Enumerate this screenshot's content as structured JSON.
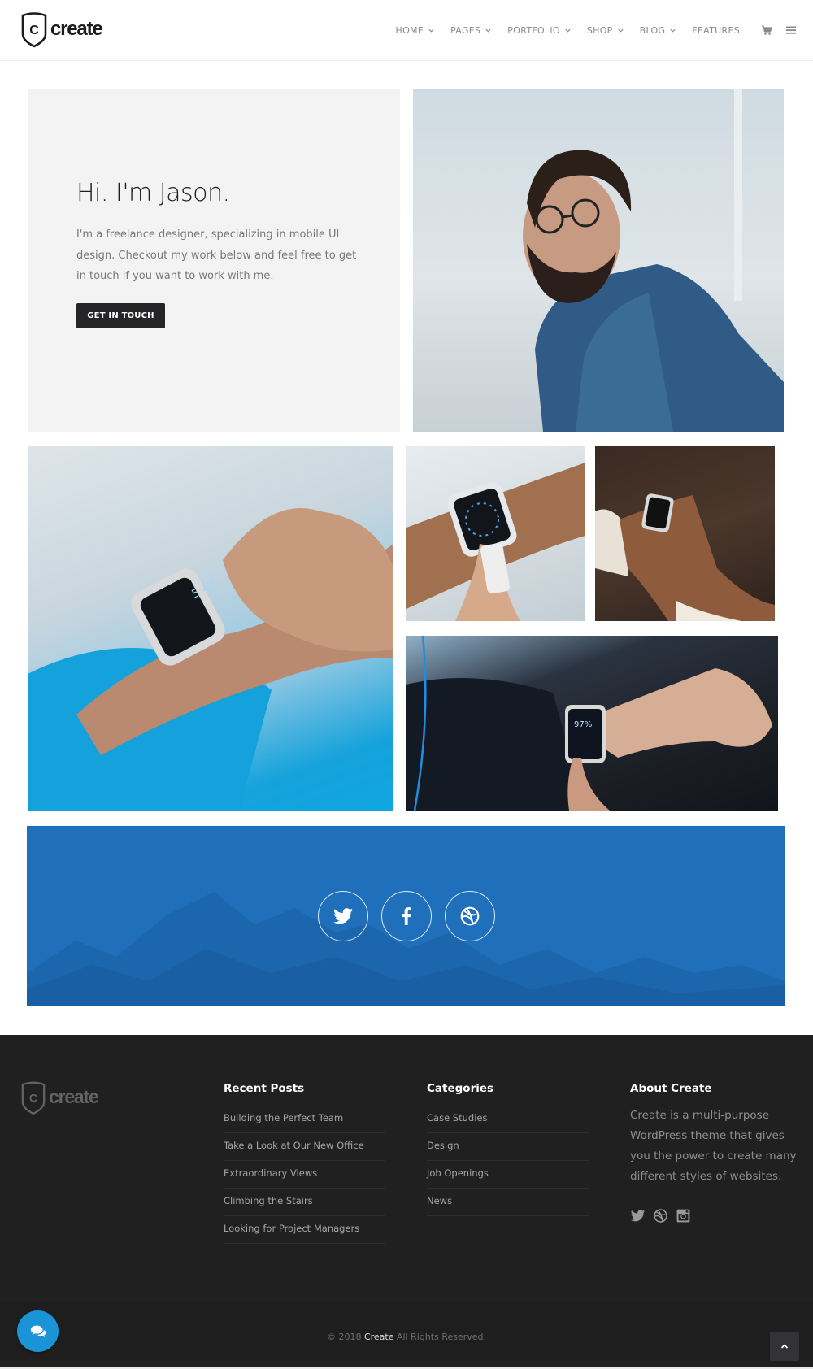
{
  "brand": {
    "name": "create",
    "logo_letter": "C"
  },
  "nav": {
    "items": [
      {
        "label": "HOME",
        "has_dropdown": true
      },
      {
        "label": "PAGES",
        "has_dropdown": true
      },
      {
        "label": "PORTFOLIO",
        "has_dropdown": true
      },
      {
        "label": "SHOP",
        "has_dropdown": true
      },
      {
        "label": "BLOG",
        "has_dropdown": true
      },
      {
        "label": "FEATURES",
        "has_dropdown": false
      }
    ],
    "icons": [
      "cart-icon",
      "menu-icon"
    ]
  },
  "hero": {
    "title": "Hi. I'm Jason.",
    "body": "I'm a freelance designer, specializing in mobile UI design. Checkout my work below and feel free to get in touch if you want to work with me.",
    "button_label": "GET IN TOUCH"
  },
  "gallery": [
    {
      "name": "portrait-photo",
      "subject": "bearded man with glasses in denim shirt"
    },
    {
      "name": "watch-photo-blue",
      "subject": "hand adjusting smartwatch showing 5:42"
    },
    {
      "name": "watch-photo-white",
      "subject": "finger tapping smartwatch with white band"
    },
    {
      "name": "watch-photo-wood",
      "subject": "hands with smartwatch on wooden table"
    },
    {
      "name": "watch-photo-car",
      "subject": "smartwatch in car showing 97%"
    }
  ],
  "social_band": {
    "color": "#1f6fba",
    "icons": [
      "twitter-icon",
      "facebook-icon",
      "dribbble-icon"
    ]
  },
  "footer": {
    "recent_posts": {
      "title": "Recent Posts",
      "items": [
        "Building the Perfect Team",
        "Take a Look at Our New Office",
        "Extraordinary Views",
        "Climbing the Stairs",
        "Looking for Project Managers"
      ]
    },
    "categories": {
      "title": "Categories",
      "items": [
        "Case Studies",
        "Design",
        "Job Openings",
        "News"
      ]
    },
    "about": {
      "title": "About Create",
      "text": "Create is a multi-purpose WordPress theme that gives you the power to create many different styles of websites.",
      "icons": [
        "twitter-icon",
        "dribbble-icon",
        "instagram-icon"
      ]
    },
    "copyright": {
      "prefix": "© 2018",
      "brand": "Create",
      "suffix": "All Rights Reserved."
    }
  },
  "colors": {
    "accent_blue": "#1f6fba",
    "chat_blue": "#1a94d7",
    "footer_bg": "#202020",
    "hero_bg": "#f3f3f3",
    "button_dark": "#252527"
  }
}
